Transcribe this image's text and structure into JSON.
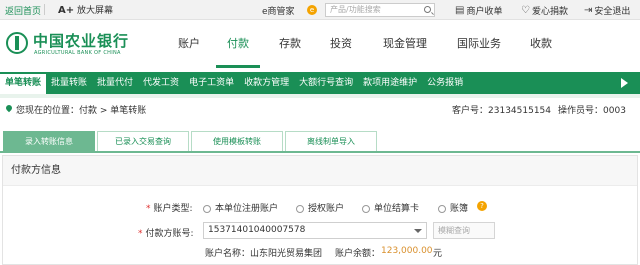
{
  "topbar": {
    "home": "返回首页",
    "font_prefix": "A+",
    "font_label": "放大屏幕",
    "ehome": "e商管家",
    "ehome_badge": "e",
    "search_placeholder": "产品/功能搜索",
    "utils": [
      {
        "icon": "shop-icon",
        "label": "商户收单"
      },
      {
        "icon": "heart-icon",
        "label": "爱心捐款"
      },
      {
        "icon": "logout-icon",
        "label": "安全退出"
      }
    ]
  },
  "logo": {
    "cn": "中国农业银行",
    "en": "AGRICULTURAL BANK OF CHINA"
  },
  "main_nav": [
    {
      "label": "账户",
      "active": false
    },
    {
      "label": "付款",
      "active": true
    },
    {
      "label": "存款",
      "active": false
    },
    {
      "label": "投资",
      "active": false
    },
    {
      "label": "现金管理",
      "active": false
    },
    {
      "label": "国际业务",
      "active": false
    },
    {
      "label": "收款",
      "active": false
    }
  ],
  "sub_nav": [
    {
      "label": "单笔转账",
      "active": true
    },
    {
      "label": "批量转账",
      "active": false
    },
    {
      "label": "批量代付",
      "active": false
    },
    {
      "label": "代发工资",
      "active": false
    },
    {
      "label": "电子工资单",
      "active": false
    },
    {
      "label": "收款方管理",
      "active": false
    },
    {
      "label": "大额行号查询",
      "active": false
    },
    {
      "label": "款项用途维护",
      "active": false
    },
    {
      "label": "公务报销",
      "active": false
    }
  ],
  "location": {
    "label": "您现在的位置：付款 > 单笔转账",
    "customer_label": "客户号：",
    "customer_no": "23134515154",
    "operator_label": "操作员号：",
    "operator_no": "0003"
  },
  "tabs": [
    {
      "label": "录入转账信息",
      "active": true
    },
    {
      "label": "已录入交易查询",
      "active": false
    },
    {
      "label": "使用模板转账",
      "active": false
    },
    {
      "label": "离线制单导入",
      "active": false
    }
  ],
  "panel": {
    "title": "付款方信息",
    "account_type_label": "账户类型:",
    "account_type_options": [
      "本单位注册账户",
      "授权账户",
      "单位结算卡",
      "账簿"
    ],
    "help_badge": "?",
    "payer_account_label": "付款方账号:",
    "payer_account_value": "15371401040007578",
    "query_placeholder": "模糊查询",
    "account_name_label": "账户名称：",
    "account_name_value": "山东阳光贸易集团",
    "balance_label": "账户余额：",
    "balance_value": "123,000.00",
    "balance_unit": "元"
  }
}
